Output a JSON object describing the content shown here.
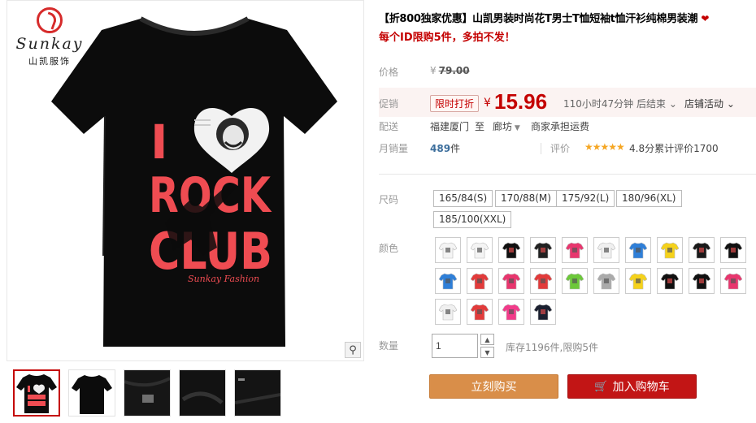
{
  "brand": {
    "name": "Sunkay",
    "cn": "山凯服饰"
  },
  "product": {
    "title": "【折800独家优惠】山凯男装时尚花T男士T恤短袖t恤汗衫纯棉男装潮",
    "subtitle": "每个ID限购5件，多拍不发！",
    "print_text": {
      "line1": "I",
      "line2": "ROCK",
      "line3": "CLUB",
      "line4": "Sunkay Fashion"
    }
  },
  "price": {
    "label": "价格",
    "currency": "¥",
    "original": "79.00"
  },
  "promo": {
    "label": "促销",
    "tag": "限时打折",
    "currency": "¥",
    "price": "15.96",
    "countdown": "110小时47分钟 后结束",
    "shop_activity": "店铺活动"
  },
  "shipping": {
    "label": "配送",
    "from": "福建厦门",
    "sep": "至",
    "to": "廊坊",
    "free": "商家承担运费"
  },
  "sales": {
    "label": "月销量",
    "count": "489",
    "unit": "件",
    "rate_label": "评价",
    "stars": "★★★★★",
    "rate_text": "4.8分累计评价1700"
  },
  "size": {
    "label": "尺码",
    "options": [
      "165/84(S)",
      "170/88(M)",
      "175/92(L)",
      "180/96(XL)",
      "185/100(XXL)"
    ]
  },
  "color": {
    "label": "颜色",
    "swatches": [
      "#f4f4f4",
      "#f4f4f4",
      "#111111",
      "#222222",
      "#e8366e",
      "#f0f0f0",
      "#2f7fd8",
      "#f5d21b",
      "#1a1a1a",
      "#111111",
      "#2f7fd8",
      "#e23b3b",
      "#e8366e",
      "#e23b3b",
      "#6cc83a",
      "#aaaaaa",
      "#f5d21b",
      "#111111",
      "#111111",
      "#e8366e",
      "#f0f0f0",
      "#e23b3b",
      "#f23b8a",
      "#1b2030"
    ]
  },
  "quantity": {
    "label": "数量",
    "value": "1",
    "stock": "库存1196件,限购5件"
  },
  "actions": {
    "buy": "立刻购买",
    "cart": "加入购物车"
  },
  "colors": {
    "accent_red": "#c40000",
    "buy_orange": "#d98e49",
    "cart_red": "#c21515"
  }
}
